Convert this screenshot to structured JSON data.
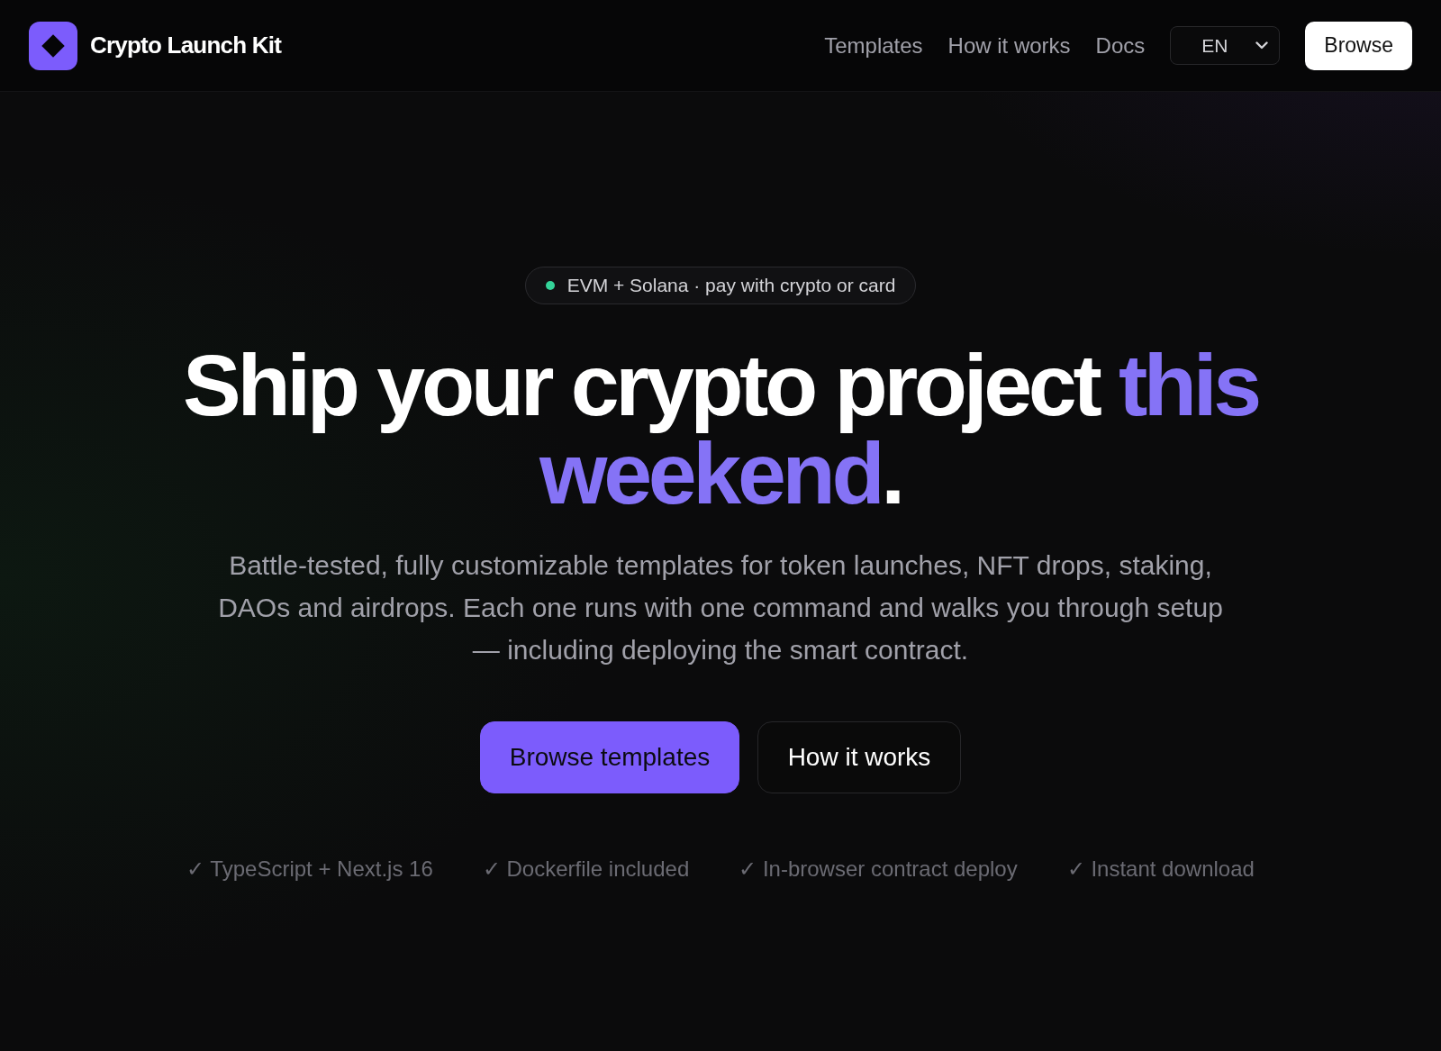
{
  "header": {
    "brand": "Crypto Launch Kit",
    "nav": [
      "Templates",
      "How it works",
      "Docs"
    ],
    "language": "EN",
    "cta": "Browse"
  },
  "hero": {
    "badge": "EVM + Solana · pay with crypto or card",
    "heading": [
      {
        "text": "Ship your crypto project ",
        "highlight": false
      },
      {
        "text": "this weekend",
        "highlight": true
      },
      {
        "text": ".",
        "highlight": false
      }
    ],
    "description": "Battle-tested, fully customizable templates for token launches, NFT drops, staking, DAOs and airdrops. Each one runs with one command and walks you through setup — including deploying the smart contract.",
    "buttons": [
      {
        "label": "Browse templates",
        "kind": "primary"
      },
      {
        "label": "How it works",
        "kind": "secondary"
      }
    ],
    "features": [
      "✓ TypeScript + Next.js 16",
      "✓ Dockerfile included",
      "✓ In-browser contract deploy",
      "✓ Instant download"
    ]
  }
}
